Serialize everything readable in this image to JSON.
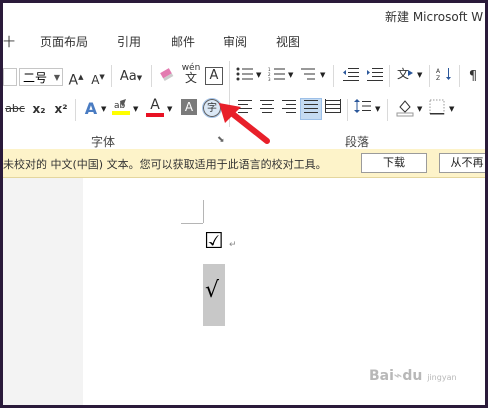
{
  "window": {
    "title": "新建 Microsoft W"
  },
  "tabs": [
    {
      "label": "十"
    },
    {
      "label": "页面布局"
    },
    {
      "label": "引用"
    },
    {
      "label": "邮件"
    },
    {
      "label": "审阅"
    },
    {
      "label": "视图"
    }
  ],
  "ribbon": {
    "font_size_value": "二号",
    "font_group_label": "字体",
    "paragraph_group_label": "段落",
    "grow_font": "A",
    "shrink_font": "A",
    "change_case": "Aa",
    "phonetic_top": "wén",
    "phonetic_bottom": "文",
    "char_border": "A",
    "strike": "abc",
    "subscript": "x₂",
    "superscript": "x²",
    "text_effect": "A",
    "font_color": "A",
    "char_shading": "A",
    "enclose_char": "字",
    "highlight_color": "#ffff00",
    "font_color_value": "#e81123"
  },
  "message_bar": {
    "text": "未校对的 中文(中国) 文本。您可以获取适用于此语言的校对工具。",
    "download_label": "下载",
    "dismiss_label": "从不再"
  },
  "document": {
    "checkbox_char": "☑",
    "pilcrow": "↵",
    "sqrt_char": "√"
  },
  "watermark": {
    "text": "Bai",
    "suffix": "du",
    "small": "jingyan"
  }
}
